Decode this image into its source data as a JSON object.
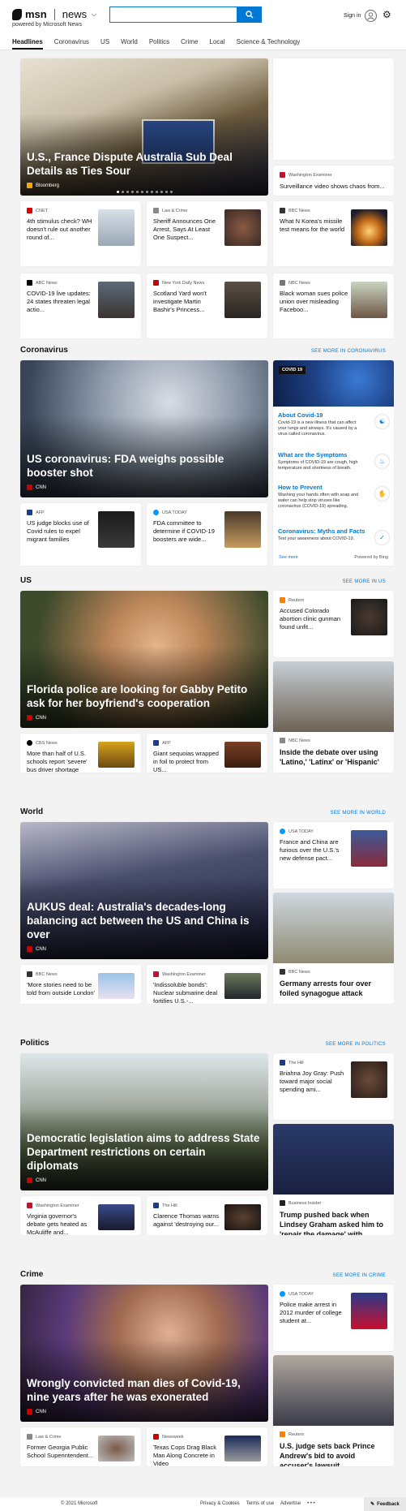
{
  "header": {
    "brand": "msn",
    "section": "news",
    "powered_by": "powered by Microsoft News",
    "search_value": "",
    "sign_in": "Sign in"
  },
  "nav": [
    "Headlines",
    "Coronavirus",
    "US",
    "World",
    "Politics",
    "Crime",
    "Local",
    "Science & Technology"
  ],
  "headlines": {
    "hero": {
      "title": "U.S., France Dispute Australia Sub Deal Details as Ties Sour",
      "source": "Bloomberg"
    },
    "side": {
      "source": "Washington Examiner",
      "title": "Surveillance video shows chaos from..."
    },
    "row1": [
      {
        "source": "CNET",
        "title": "4th stimulus check? WH doesn't rule out another round of..."
      },
      {
        "source": "Law & Crime",
        "title": "Sheriff Announces One Arrest, Says At Least One Suspect..."
      },
      {
        "source": "BBC News",
        "title": "What N Korea's missile test means for the world"
      }
    ],
    "row2": [
      {
        "source": "ABC News",
        "title": "COVID-19 live updates: 24 states threaten legal actio..."
      },
      {
        "source": "New York Daily News",
        "title": "Scotland Yard won't investigate Martin Bashir's Princess..."
      },
      {
        "source": "NBC News",
        "title": "Black woman sues police union over misleading Faceboo..."
      }
    ]
  },
  "coronavirus": {
    "title": "Coronavirus",
    "see_more": "SEE MORE IN CORONAVIRUS",
    "hero": {
      "title": "US coronavirus: FDA weighs possible booster shot",
      "source": "CNN"
    },
    "row": [
      {
        "source": "AFP",
        "title": "US judge blocks use of Covid rules to expel migrant families"
      },
      {
        "source": "USA TODAY",
        "title": "FDA committee to determine if COVID-19 boosters are wide..."
      }
    ],
    "widget": {
      "badge": "COVID 19",
      "items": [
        {
          "title": "About Covid-19",
          "desc": "Covid-19 is a new illness that can affect your lungs and airways. It's caused by a virus called coronavirus."
        },
        {
          "title": "What are the Symptoms",
          "desc": "Symptoms of COVID-19 are cough, high temperature and shortness of breath."
        },
        {
          "title": "How to Prevent",
          "desc": "Washing your hands often with soap and water can help stop viruses like coronavirus (COVID-19) spreading."
        },
        {
          "title": "Coronavirus: Myths and Facts",
          "desc": "Test your awareness about COVID-19."
        }
      ],
      "see_more": "See more",
      "powered": "Powered by Bing"
    }
  },
  "us": {
    "title": "US",
    "see_more": "SEE MORE IN US",
    "hero": {
      "title": "Florida police are looking for Gabby Petito ask for her boyfriend's cooperation",
      "source": "CNN"
    },
    "side_small": {
      "source": "Reuters",
      "title": "Accused Colorado abortion clinic gunman found unfit..."
    },
    "side_photo": {
      "source": "NBC News",
      "title": "Inside the debate over using 'Latino,' 'Latinx' or 'Hispanic'"
    },
    "row": [
      {
        "source": "CBS News",
        "title": "More than half of U.S. schools report 'severe' bus driver shortage"
      },
      {
        "source": "AFP",
        "title": "Giant sequoias wrapped in foil to protect from US..."
      }
    ]
  },
  "world": {
    "title": "World",
    "see_more": "SEE MORE IN WORLD",
    "hero": {
      "title": "AUKUS deal: Australia's decades-long balancing act between the US and China is over",
      "source": "CNN"
    },
    "side_small": {
      "source": "USA TODAY",
      "title": "France and China are furious over the U.S.'s new defense pact..."
    },
    "side_photo": {
      "source": "BBC News",
      "title": "Germany arrests four over foiled synagogue attack"
    },
    "row": [
      {
        "source": "BBC News",
        "title": "'More stories need to be told from outside London'"
      },
      {
        "source": "Washington Examiner",
        "title": "'Indissoluble bonds': Nuclear submarine deal fortifies U.S.-..."
      }
    ]
  },
  "politics": {
    "title": "Politics",
    "see_more": "SEE MORE IN POLITICS",
    "hero": {
      "title": "Democratic legislation aims to address State Department restrictions on certain diplomats",
      "source": "CNN"
    },
    "side_small": {
      "source": "The Hill",
      "title": "Briahna Joy Gray: Push toward major social spending ami..."
    },
    "side_photo": {
      "source": "Business Insider",
      "title": "Trump pushed back when Lindsey Graham asked him to 'repair the damage' with..."
    },
    "row": [
      {
        "source": "Washington Examiner",
        "title": "Virginia governor's debate gets heated as McAuliffe and..."
      },
      {
        "source": "The Hill",
        "title": "Clarence Thomas warns against 'destroying our..."
      }
    ]
  },
  "crime": {
    "title": "Crime",
    "see_more": "SEE MORE IN CRIME",
    "hero": {
      "title": "Wrongly convicted man dies of Covid-19, nine years after he was exonerated",
      "source": "CNN"
    },
    "side_small": {
      "source": "USA TODAY",
      "title": "Police make arrest in 2012 murder of college student at..."
    },
    "side_photo": {
      "source": "Reuters",
      "title": "U.S. judge sets back Prince Andrew's bid to avoid accuser's lawsuit"
    },
    "row": [
      {
        "source": "Law & Crime",
        "title": "Former Georgia Public School Superintendent..."
      },
      {
        "source": "Newsweek",
        "title": "Texas Cops Drag Black Man Along Concrete in Video"
      }
    ]
  },
  "footer": {
    "copyright": "© 2021 Microsoft",
    "links": [
      "Privacy & Cookies",
      "Terms of use",
      "Advertise"
    ],
    "more": "• • •",
    "feedback": "Feedback"
  }
}
